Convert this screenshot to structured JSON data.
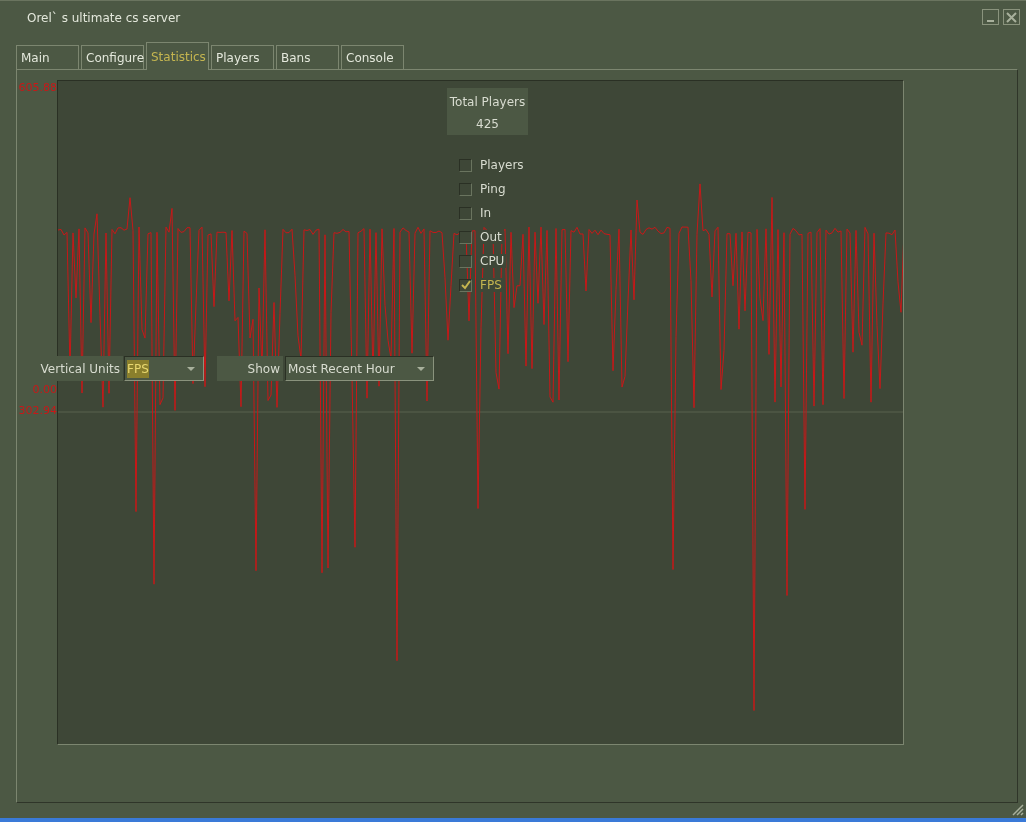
{
  "window": {
    "title": "Orel` s ultimate cs server"
  },
  "tabs": [
    {
      "label": "Main",
      "selected": false
    },
    {
      "label": "Configure",
      "selected": false
    },
    {
      "label": "Statistics",
      "selected": true
    },
    {
      "label": "Players",
      "selected": false
    },
    {
      "label": "Bans",
      "selected": false
    },
    {
      "label": "Console",
      "selected": false
    }
  ],
  "graph": {
    "axis_labels": [
      "605.88",
      "0.00",
      "302.94"
    ],
    "total_players": {
      "label": "Total Players",
      "value": "425"
    },
    "series_toggles": [
      {
        "label": "Players",
        "checked": false
      },
      {
        "label": "Ping",
        "checked": false
      },
      {
        "label": "In",
        "checked": false
      },
      {
        "label": "Out",
        "checked": false
      },
      {
        "label": "CPU",
        "checked": false
      },
      {
        "label": "FPS",
        "checked": true
      }
    ],
    "vertical_units": {
      "label": "Vertical Units",
      "value": "FPS"
    },
    "show": {
      "label": "Show",
      "value": "Most Recent Hour"
    }
  }
}
